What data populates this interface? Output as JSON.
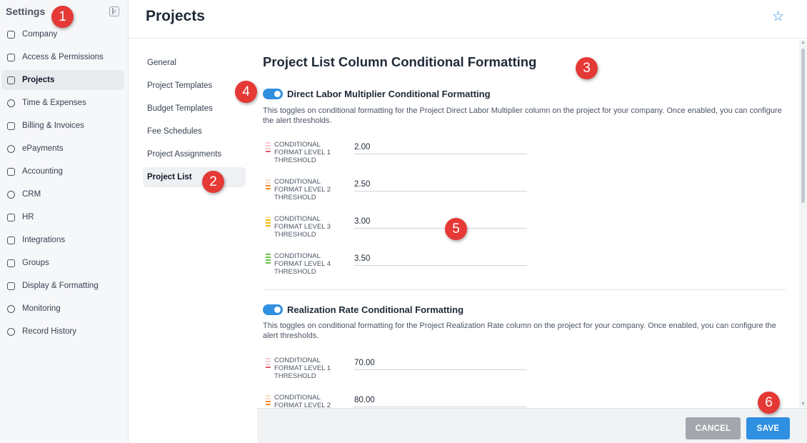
{
  "sidebar": {
    "title": "Settings",
    "items": [
      {
        "label": "Company",
        "icon": "building-icon",
        "active": false
      },
      {
        "label": "Access & Permissions",
        "icon": "lock-icon",
        "active": false
      },
      {
        "label": "Projects",
        "icon": "briefcase-icon",
        "active": true
      },
      {
        "label": "Time & Expenses",
        "icon": "clock-icon",
        "active": false
      },
      {
        "label": "Billing & Invoices",
        "icon": "invoice-icon",
        "active": false
      },
      {
        "label": "ePayments",
        "icon": "payment-icon",
        "active": false
      },
      {
        "label": "Accounting",
        "icon": "calculator-icon",
        "active": false
      },
      {
        "label": "CRM",
        "icon": "share-icon",
        "active": false
      },
      {
        "label": "HR",
        "icon": "id-badge-icon",
        "active": false
      },
      {
        "label": "Integrations",
        "icon": "integrations-icon",
        "active": false
      },
      {
        "label": "Groups",
        "icon": "layers-icon",
        "active": false
      },
      {
        "label": "Display & Formatting",
        "icon": "display-icon",
        "active": false
      },
      {
        "label": "Monitoring",
        "icon": "bell-icon",
        "active": false
      },
      {
        "label": "Record History",
        "icon": "history-icon",
        "active": false
      }
    ]
  },
  "header": {
    "title": "Projects"
  },
  "subnav": {
    "items": [
      {
        "label": "General",
        "active": false
      },
      {
        "label": "Project Templates",
        "active": false
      },
      {
        "label": "Budget Templates",
        "active": false
      },
      {
        "label": "Fee Schedules",
        "active": false
      },
      {
        "label": "Project Assignments",
        "active": false
      },
      {
        "label": "Project List",
        "active": true
      }
    ]
  },
  "main": {
    "section_title": "Project List Column Conditional Formatting",
    "groups": [
      {
        "toggle_label": "Direct Labor Multiplier Conditional Formatting",
        "enabled": true,
        "description": "This toggles on conditional formatting for the Project Direct Labor Multiplier column on the project for your company. Once enabled, you can configure the alert thresholds.",
        "thresholds": [
          {
            "label": "CONDITIONAL FORMAT LEVEL 1 THRESHOLD",
            "value": "2.00",
            "level": 1
          },
          {
            "label": "CONDITIONAL FORMAT LEVEL 2 THRESHOLD",
            "value": "2.50",
            "level": 2
          },
          {
            "label": "CONDITIONAL FORMAT LEVEL 3 THRESHOLD",
            "value": "3.00",
            "level": 3
          },
          {
            "label": "CONDITIONAL FORMAT LEVEL 4 THRESHOLD",
            "value": "3.50",
            "level": 4
          }
        ]
      },
      {
        "toggle_label": "Realization Rate Conditional Formatting",
        "enabled": true,
        "description": "This toggles on conditional formatting for the Project Realization Rate column on the project for your company. Once enabled, you can configure the alert thresholds.",
        "thresholds": [
          {
            "label": "CONDITIONAL FORMAT LEVEL 1 THRESHOLD",
            "value": "70.00",
            "level": 1
          },
          {
            "label": "CONDITIONAL FORMAT LEVEL 2",
            "value": "80.00",
            "level": 2
          }
        ]
      }
    ]
  },
  "footer": {
    "cancel_label": "CANCEL",
    "save_label": "SAVE"
  },
  "markers": [
    "1",
    "2",
    "3",
    "4",
    "5",
    "6"
  ],
  "colors": {
    "accent": "#2f8fe0",
    "marker": "#e53935",
    "level1": "#e25b6a",
    "level2": "#f08a24",
    "level3": "#f2b705",
    "level4": "#6cc04a"
  }
}
